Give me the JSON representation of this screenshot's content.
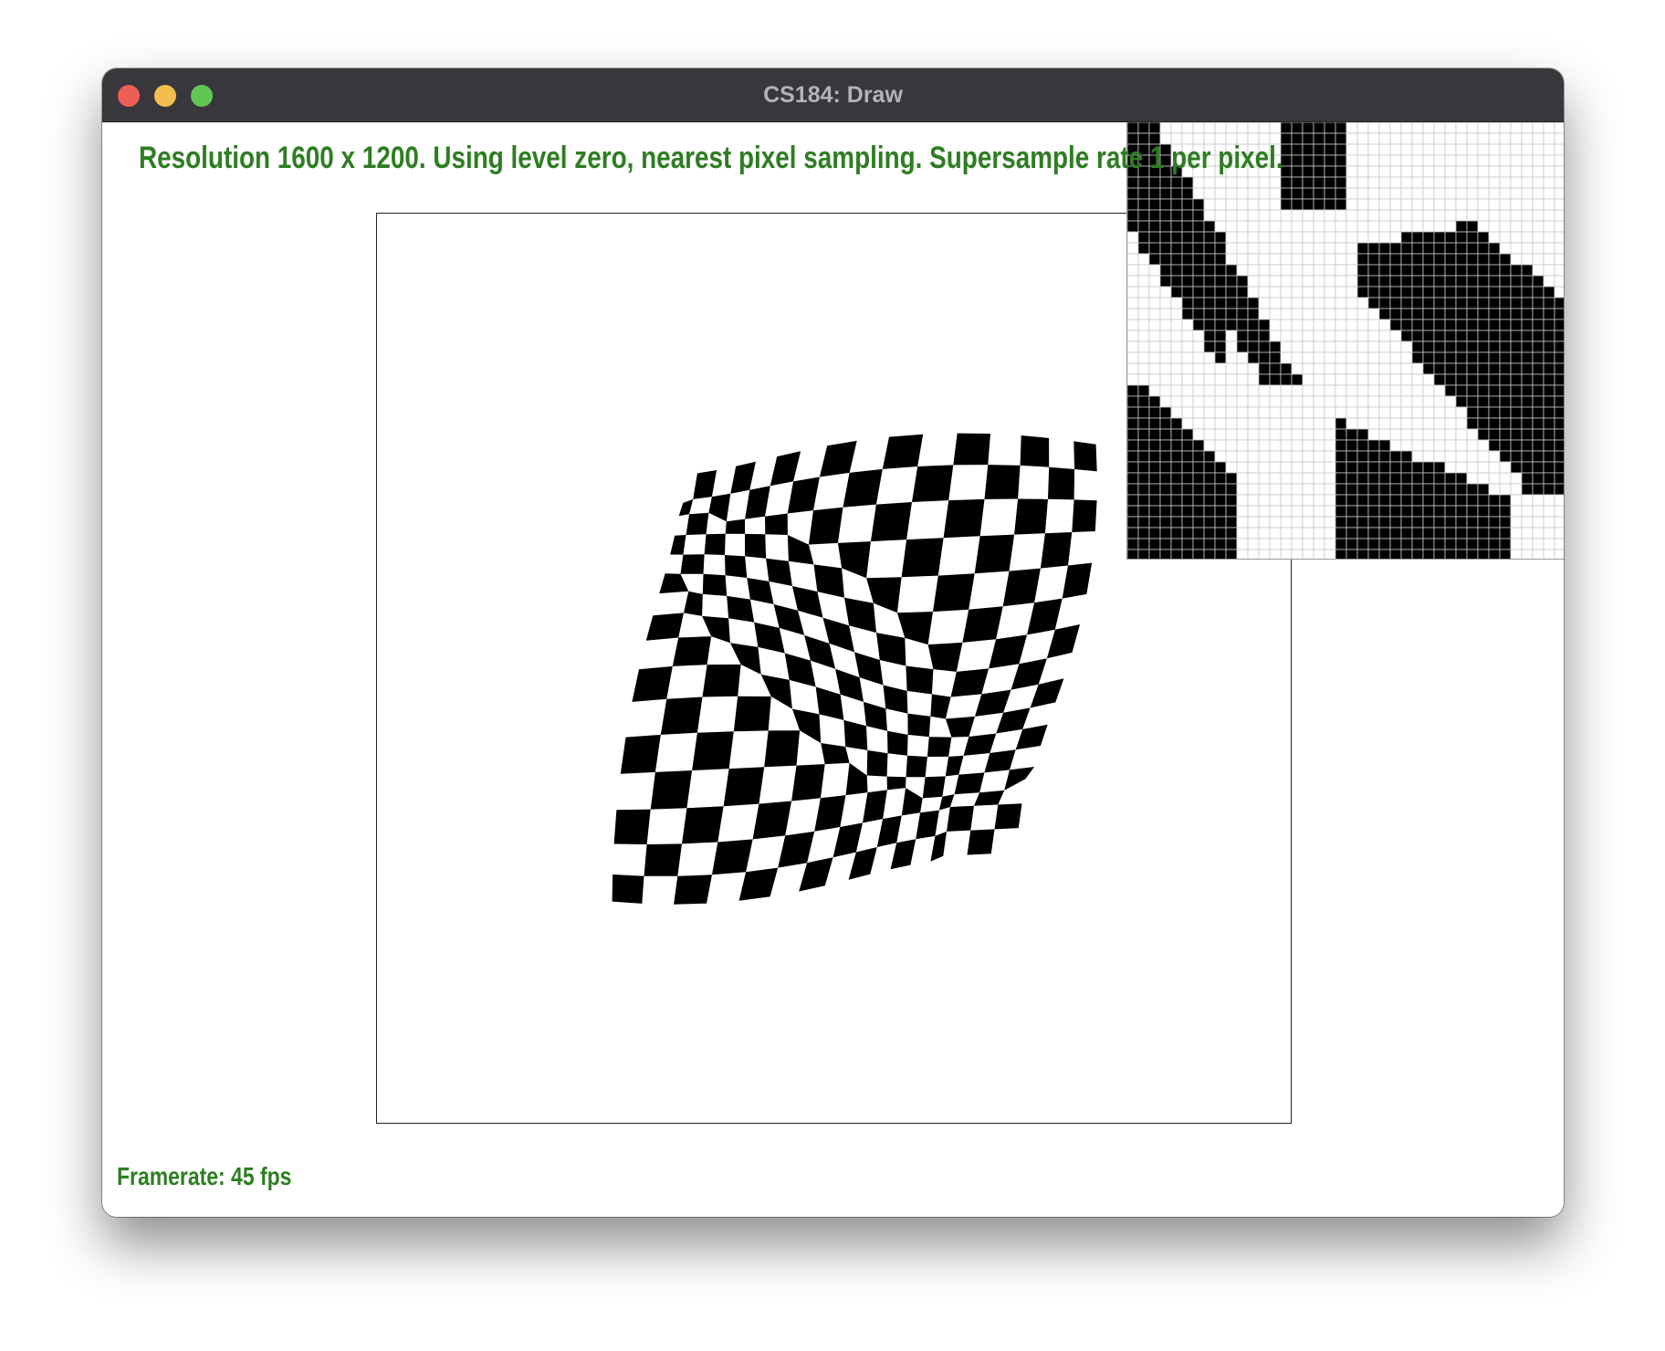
{
  "window": {
    "title": "CS184: Draw"
  },
  "status": {
    "text": "Resolution 1600 x 1200. Using level zero, nearest pixel sampling. Supersample rate 1 per pixel."
  },
  "footer": {
    "framerate": "Framerate: 45 fps"
  },
  "icons": {
    "close": "close-traffic-light-icon",
    "minimize": "minimize-traffic-light-icon",
    "maximize": "maximize-traffic-light-icon"
  },
  "colors": {
    "status_text": "#2e7d22",
    "titlebar": "#38373b",
    "close": "#ec5f57",
    "minimize": "#f4bd4f",
    "maximize": "#62c654"
  }
}
